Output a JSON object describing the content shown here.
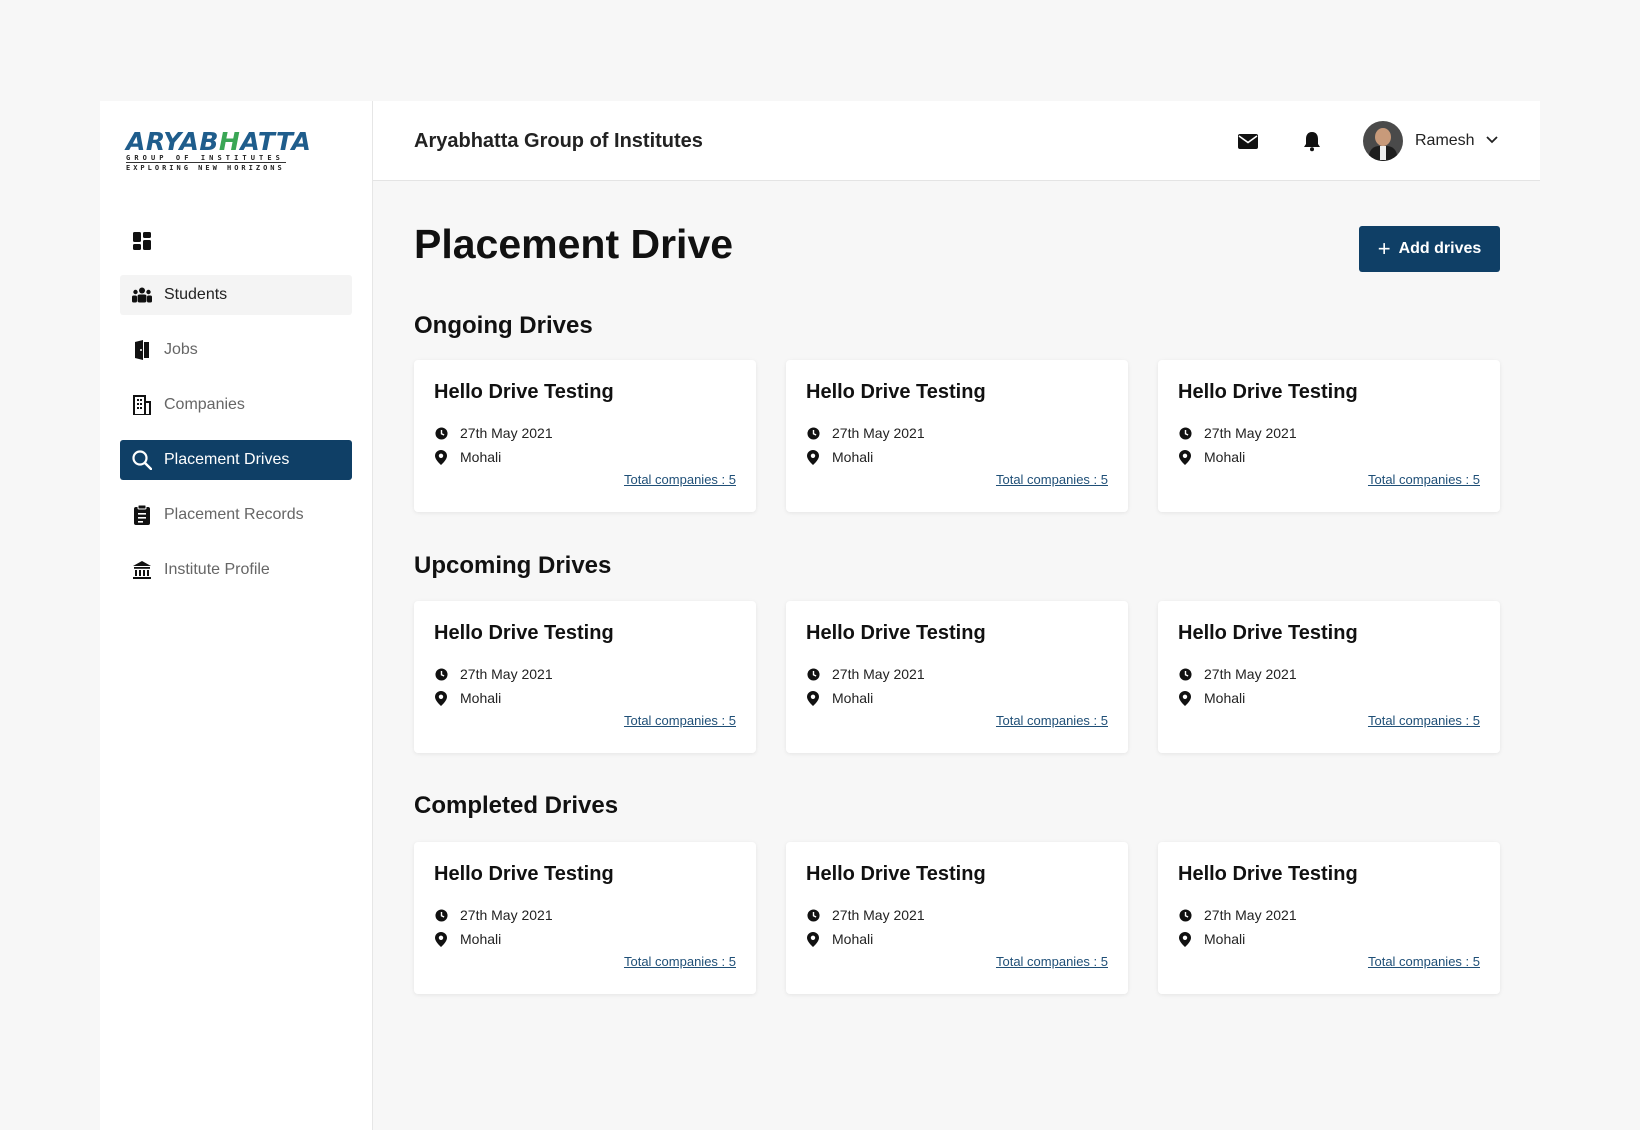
{
  "brand": {
    "logo_main": "ARYABHATTA",
    "logo_line1": "GROUP OF INSTITUTES",
    "logo_line2": "EXPLORING NEW HORIZONS"
  },
  "sidebar": {
    "items": [
      {
        "label": "Students",
        "icon": "students-icon"
      },
      {
        "label": "Jobs",
        "icon": "jobs-icon"
      },
      {
        "label": "Companies",
        "icon": "companies-icon"
      },
      {
        "label": "Placement Drives",
        "icon": "search-icon"
      },
      {
        "label": "Placement Records",
        "icon": "clipboard-icon"
      },
      {
        "label": "Institute Profile",
        "icon": "institution-icon"
      }
    ]
  },
  "header": {
    "title": "Aryabhatta Group of Institutes",
    "user_name": "Ramesh"
  },
  "main": {
    "page_title": "Placement Drive",
    "add_button": "Add drives",
    "sections": [
      {
        "title": "Ongoing Drives",
        "cards": [
          {
            "title": "Hello Drive Testing",
            "date": "27th May 2021",
            "location": "Mohali",
            "link": "Total companies : 5"
          },
          {
            "title": "Hello Drive Testing",
            "date": "27th May 2021",
            "location": "Mohali",
            "link": "Total companies : 5"
          },
          {
            "title": "Hello Drive Testing",
            "date": "27th May 2021",
            "location": "Mohali",
            "link": "Total companies : 5"
          }
        ]
      },
      {
        "title": "Upcoming Drives",
        "cards": [
          {
            "title": "Hello Drive Testing",
            "date": "27th May 2021",
            "location": "Mohali",
            "link": "Total companies : 5"
          },
          {
            "title": "Hello Drive Testing",
            "date": "27th May 2021",
            "location": "Mohali",
            "link": "Total companies : 5"
          },
          {
            "title": "Hello Drive Testing",
            "date": "27th May 2021",
            "location": "Mohali",
            "link": "Total companies : 5"
          }
        ]
      },
      {
        "title": "Completed Drives",
        "cards": [
          {
            "title": "Hello Drive Testing",
            "date": "27th May 2021",
            "location": "Mohali",
            "link": "Total companies : 5"
          },
          {
            "title": "Hello Drive Testing",
            "date": "27th May 2021",
            "location": "Mohali",
            "link": "Total companies : 5"
          },
          {
            "title": "Hello Drive Testing",
            "date": "27th May 2021",
            "location": "Mohali",
            "link": "Total companies : 5"
          }
        ]
      }
    ]
  },
  "colors": {
    "primary": "#0f3f66",
    "link": "#1f4f77",
    "background": "#f7f7f7"
  }
}
